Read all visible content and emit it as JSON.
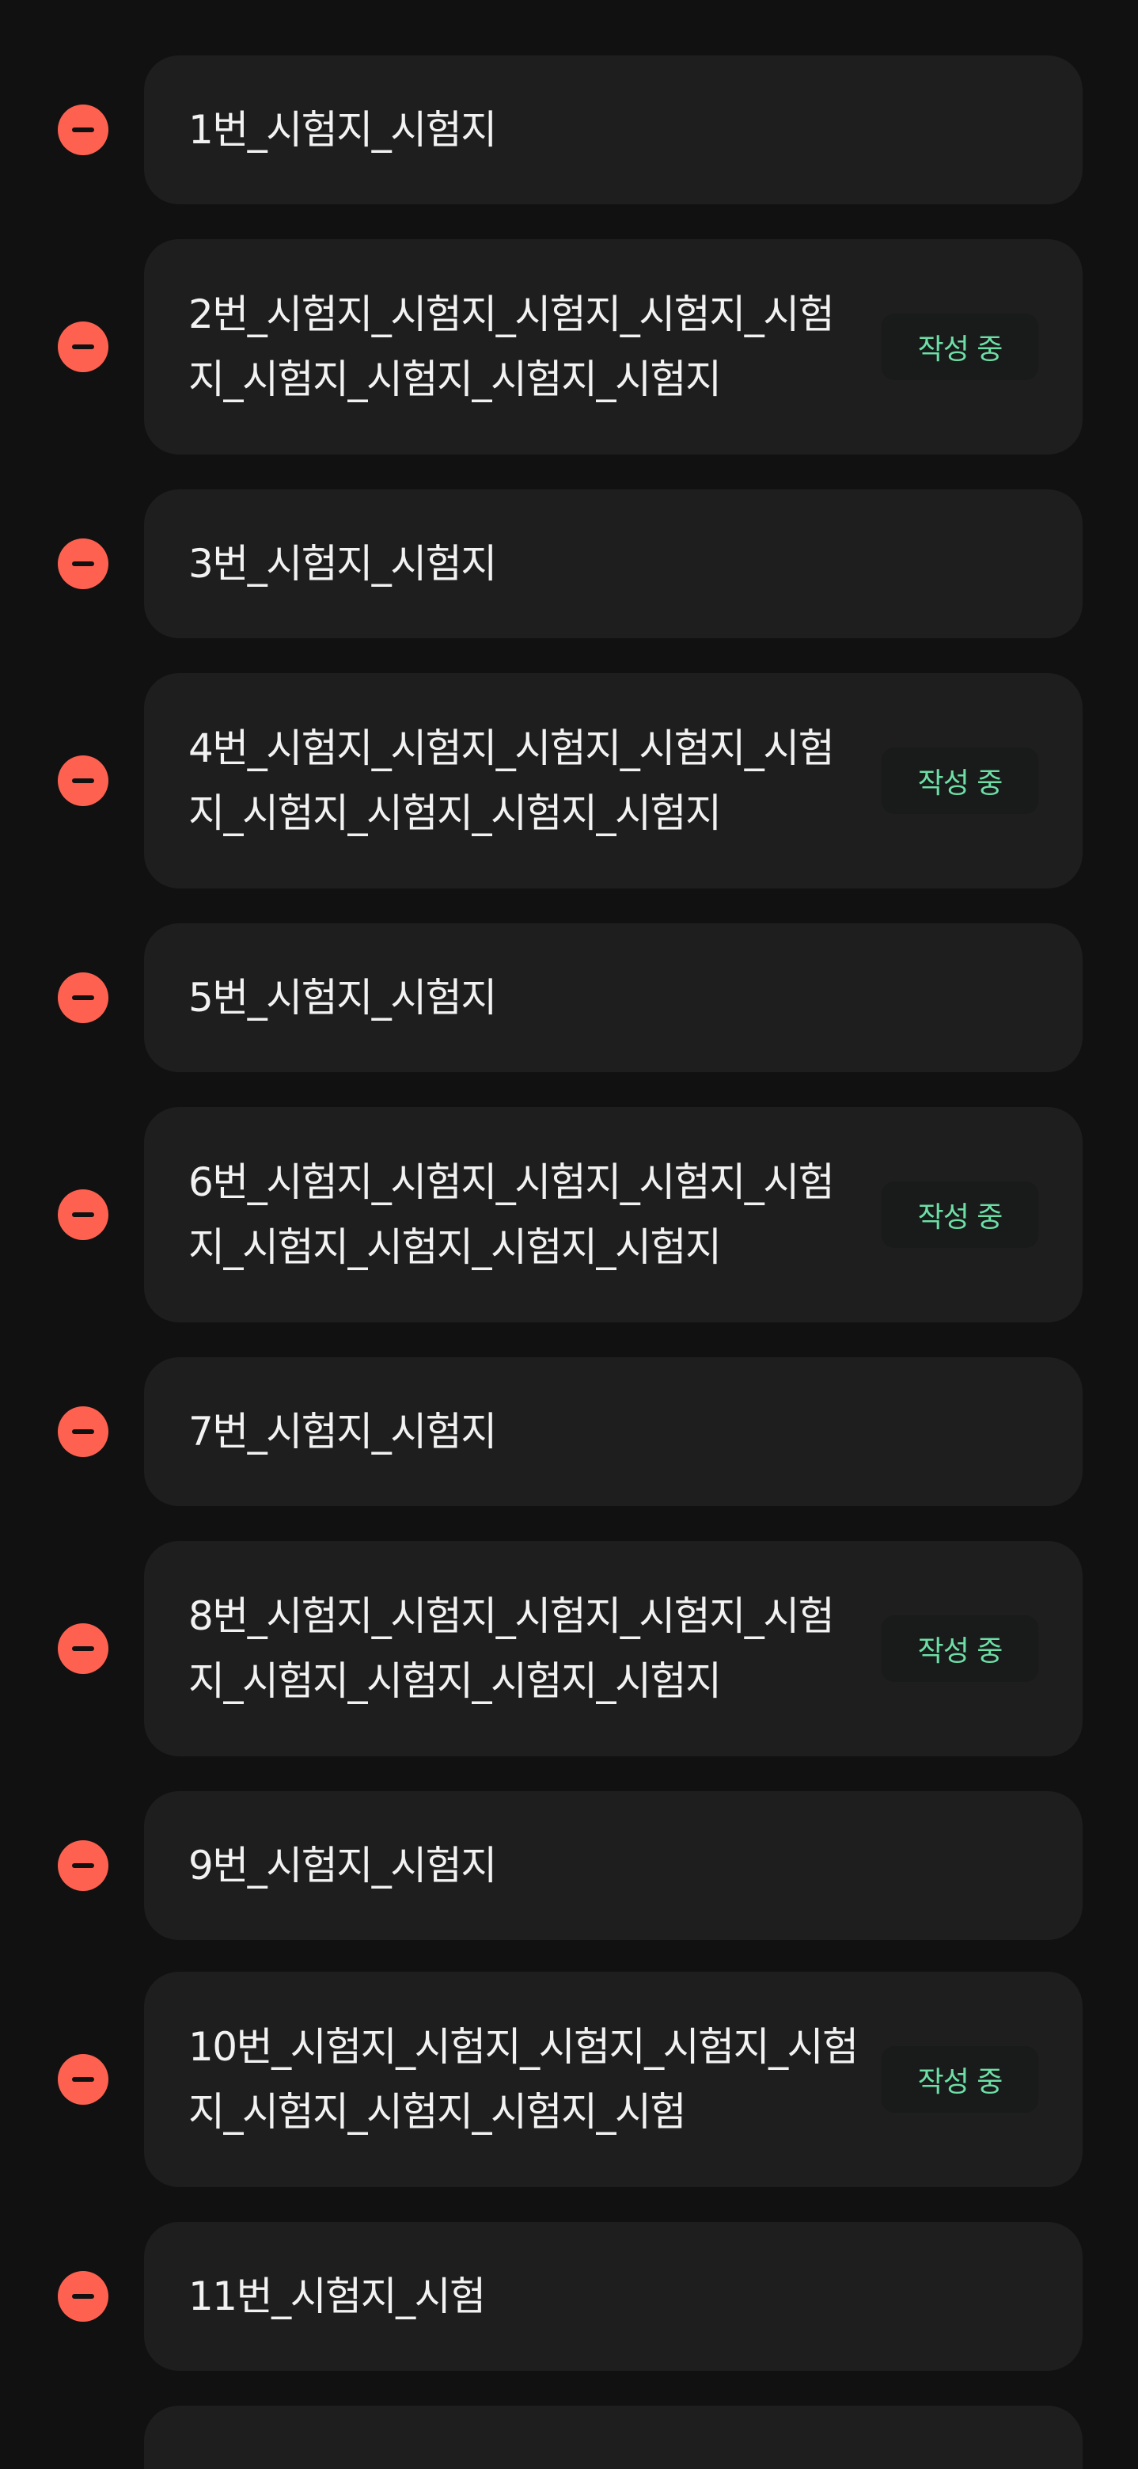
{
  "items": [
    {
      "title": "1번_시험지_시험지",
      "badge": ""
    },
    {
      "title": "2번_시험지_시험지_시험지_시험지_시험지_시험지_시험지_시험지_시험지",
      "badge": "작성 중"
    },
    {
      "title": "3번_시험지_시험지",
      "badge": ""
    },
    {
      "title": "4번_시험지_시험지_시험지_시험지_시험지_시험지_시험지_시험지_시험지",
      "badge": "작성 중"
    },
    {
      "title": "5번_시험지_시험지",
      "badge": ""
    },
    {
      "title": "6번_시험지_시험지_시험지_시험지_시험지_시험지_시험지_시험지_시험지",
      "badge": "작성 중"
    },
    {
      "title": "7번_시험지_시험지",
      "badge": ""
    },
    {
      "title": "8번_시험지_시험지_시험지_시험지_시험지_시험지_시험지_시험지_시험지",
      "badge": "작성 중"
    },
    {
      "title": "9번_시험지_시험지",
      "badge": ""
    },
    {
      "title": "10번_시험지_시험지_시험지_시험지_시험지_시험지_시험지_시험지_시험",
      "badge": "작성 중"
    },
    {
      "title": "11번_시험지_시험",
      "badge": ""
    },
    {
      "title": "",
      "badge": ""
    }
  ],
  "icons": {
    "remove": "minus-circle-icon"
  },
  "colors": {
    "background": "#111111",
    "card": "#1E1E1F",
    "remove": "#FF6150",
    "badge_text": "#6DDFA6",
    "badge_bg": "#191A1A",
    "title_text": "#F2F2F2"
  }
}
